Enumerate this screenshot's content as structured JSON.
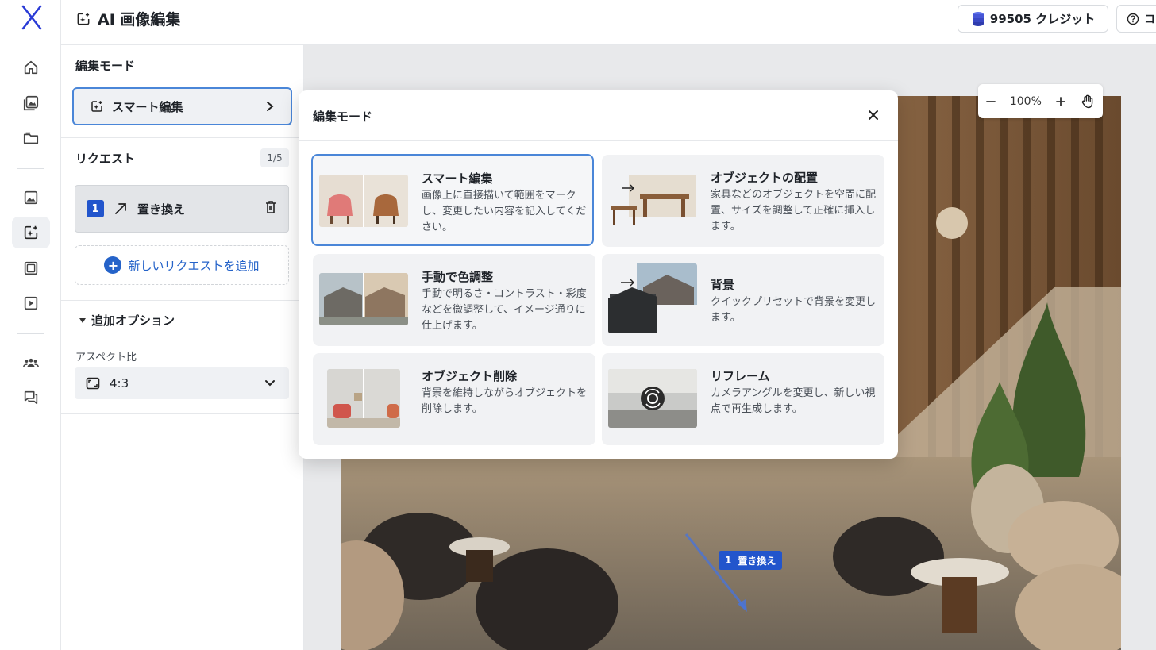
{
  "header": {
    "title": "AI 画像編集",
    "credits": "99505 クレジット",
    "help_label": "コ"
  },
  "panel": {
    "mode_section_title": "編集モード",
    "mode_selected": "スマート編集",
    "request_section_title": "リクエスト",
    "request_count": "1/5",
    "request_item": {
      "number": "1",
      "label": "置き換え"
    },
    "add_request_label": "新しいリクエストを追加",
    "options_title": "追加オプション",
    "aspect_label": "アスペクト比",
    "aspect_value": "4:3"
  },
  "canvas": {
    "zoom_level": "100%",
    "tag": {
      "number": "1",
      "label": "置き換え"
    }
  },
  "modal": {
    "title": "編集モード",
    "cards": [
      {
        "title": "スマート編集",
        "desc": "画像上に直接描いて範囲をマークし、変更したい内容を記入してください。"
      },
      {
        "title": "オブジェクトの配置",
        "desc": "家具などのオブジェクトを空間に配置、サイズを調整して正確に挿入します。"
      },
      {
        "title": "手動で色調整",
        "desc": "手動で明るさ・コントラスト・彩度などを微調整して、イメージ通りに仕上げます。"
      },
      {
        "title": "背景",
        "desc": "クイックプリセットで背景を変更します。"
      },
      {
        "title": "オブジェクト削除",
        "desc": "背景を維持しながらオブジェクトを削除します。"
      },
      {
        "title": "リフレーム",
        "desc": "カメラアングルを変更し、新しい視点で再生成します。"
      }
    ]
  },
  "colors": {
    "accent": "#2255cc",
    "selected_border": "#4a86d8"
  }
}
